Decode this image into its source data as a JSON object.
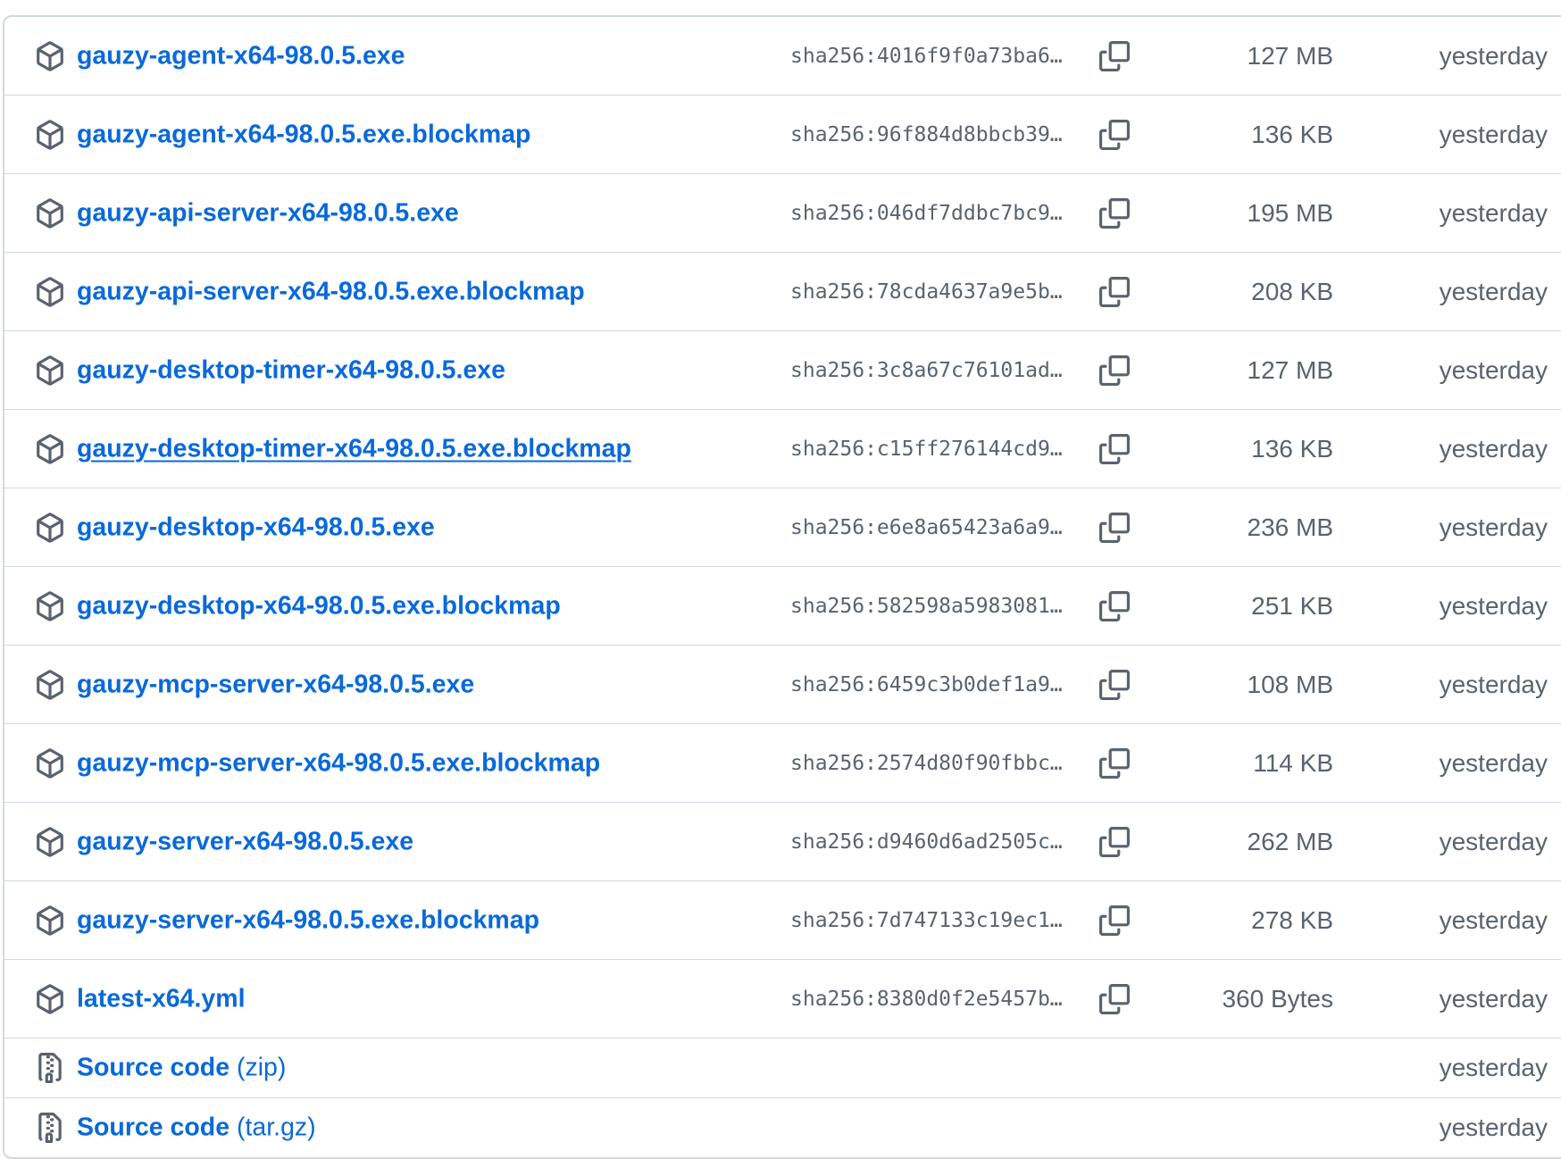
{
  "assets": [
    {
      "name": "gauzy-agent-x64-98.0.5.exe",
      "hash": "sha256:4016f9f0a73ba6…",
      "size": "127 MB",
      "date": "yesterday"
    },
    {
      "name": "gauzy-agent-x64-98.0.5.exe.blockmap",
      "hash": "sha256:96f884d8bbcb39…",
      "size": "136 KB",
      "date": "yesterday"
    },
    {
      "name": "gauzy-api-server-x64-98.0.5.exe",
      "hash": "sha256:046df7ddbc7bc9…",
      "size": "195 MB",
      "date": "yesterday"
    },
    {
      "name": "gauzy-api-server-x64-98.0.5.exe.blockmap",
      "hash": "sha256:78cda4637a9e5b…",
      "size": "208 KB",
      "date": "yesterday"
    },
    {
      "name": "gauzy-desktop-timer-x64-98.0.5.exe",
      "hash": "sha256:3c8a67c76101ad…",
      "size": "127 MB",
      "date": "yesterday"
    },
    {
      "name": "gauzy-desktop-timer-x64-98.0.5.exe.blockmap",
      "hash": "sha256:c15ff276144cd9…",
      "size": "136 KB",
      "date": "yesterday"
    },
    {
      "name": "gauzy-desktop-x64-98.0.5.exe",
      "hash": "sha256:e6e8a65423a6a9…",
      "size": "236 MB",
      "date": "yesterday"
    },
    {
      "name": "gauzy-desktop-x64-98.0.5.exe.blockmap",
      "hash": "sha256:582598a5983081…",
      "size": "251 KB",
      "date": "yesterday"
    },
    {
      "name": "gauzy-mcp-server-x64-98.0.5.exe",
      "hash": "sha256:6459c3b0def1a9…",
      "size": "108 MB",
      "date": "yesterday"
    },
    {
      "name": "gauzy-mcp-server-x64-98.0.5.exe.blockmap",
      "hash": "sha256:2574d80f90fbbc…",
      "size": "114 KB",
      "date": "yesterday"
    },
    {
      "name": "gauzy-server-x64-98.0.5.exe",
      "hash": "sha256:d9460d6ad2505c…",
      "size": "262 MB",
      "date": "yesterday"
    },
    {
      "name": "gauzy-server-x64-98.0.5.exe.blockmap",
      "hash": "sha256:7d747133c19ec1…",
      "size": "278 KB",
      "date": "yesterday"
    },
    {
      "name": "latest-x64.yml",
      "hash": "sha256:8380d0f2e5457b…",
      "size": "360 Bytes",
      "date": "yesterday"
    }
  ],
  "sources": [
    {
      "label": "Source code",
      "suffix": "(zip)",
      "date": "yesterday"
    },
    {
      "label": "Source code",
      "suffix": "(tar.gz)",
      "date": "yesterday"
    }
  ],
  "icons": {
    "asset": "package-icon",
    "source": "file-zip-icon",
    "copy": "copy-icon"
  },
  "colors": {
    "link": "#0969da",
    "muted": "#59636e",
    "border": "#d1d9e0"
  }
}
